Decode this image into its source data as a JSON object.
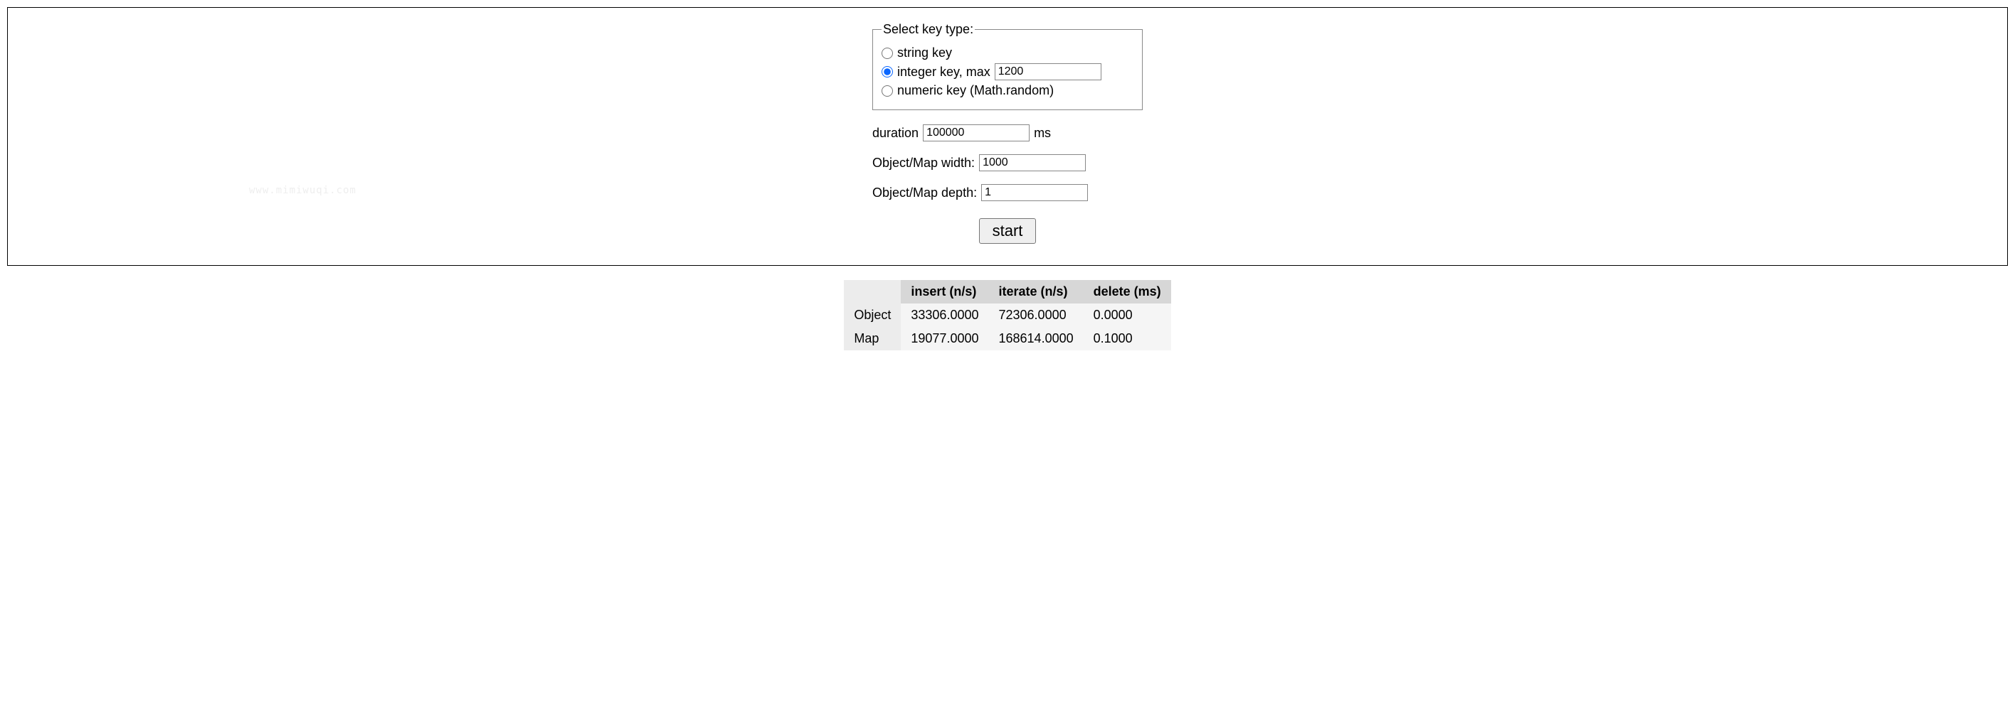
{
  "watermark": "www.mimiwuqi.com",
  "form": {
    "fieldset_legend": "Select key type:",
    "radios": {
      "string_key": {
        "label": "string key",
        "checked": false
      },
      "integer_key": {
        "label": "integer key, max",
        "checked": true,
        "max_value": "1200"
      },
      "numeric_key": {
        "label": "numeric key (Math.random)",
        "checked": false
      }
    },
    "duration": {
      "label": "duration",
      "value": "100000",
      "unit": "ms"
    },
    "width": {
      "label": "Object/Map width:",
      "value": "1000"
    },
    "depth": {
      "label": "Object/Map depth:",
      "value": "1"
    },
    "start_label": "start"
  },
  "results": {
    "headers": {
      "insert": "insert (n/s)",
      "iterate": "iterate (n/s)",
      "delete": "delete (ms)"
    },
    "rows": [
      {
        "label": "Object",
        "insert": "33306.0000",
        "iterate": "72306.0000",
        "delete": "0.0000"
      },
      {
        "label": "Map",
        "insert": "19077.0000",
        "iterate": "168614.0000",
        "delete": "0.1000"
      }
    ]
  }
}
